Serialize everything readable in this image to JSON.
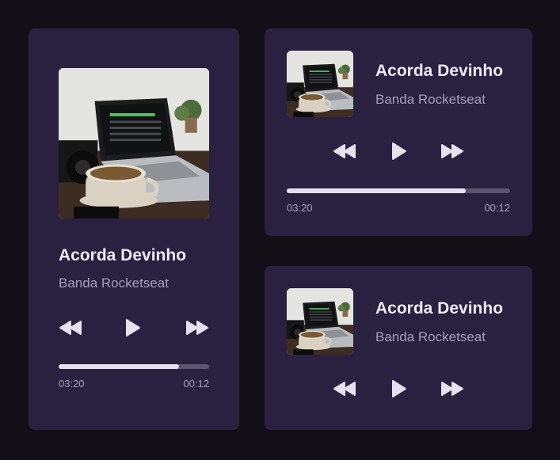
{
  "players": [
    {
      "title": "Acorda Devinho",
      "artist": "Banda Rocketseat",
      "elapsed": "03:20",
      "remaining": "00:12",
      "progress": 0.8
    },
    {
      "title": "Acorda Devinho",
      "artist": "Banda Rocketseat",
      "elapsed": "03:20",
      "remaining": "00:12",
      "progress": 0.8
    },
    {
      "title": "Acorda Devinho",
      "artist": "Banda Rocketseat"
    }
  ],
  "icons": {
    "previous": "rewind-icon",
    "play": "play-icon",
    "next": "fast-forward-icon"
  },
  "colors": {
    "background": "#121016",
    "card": "#2a2141",
    "text": "#efeaf6",
    "muted": "#a79fb7",
    "progress_fill": "#e6e1ec",
    "progress_track": "#5c5470"
  }
}
